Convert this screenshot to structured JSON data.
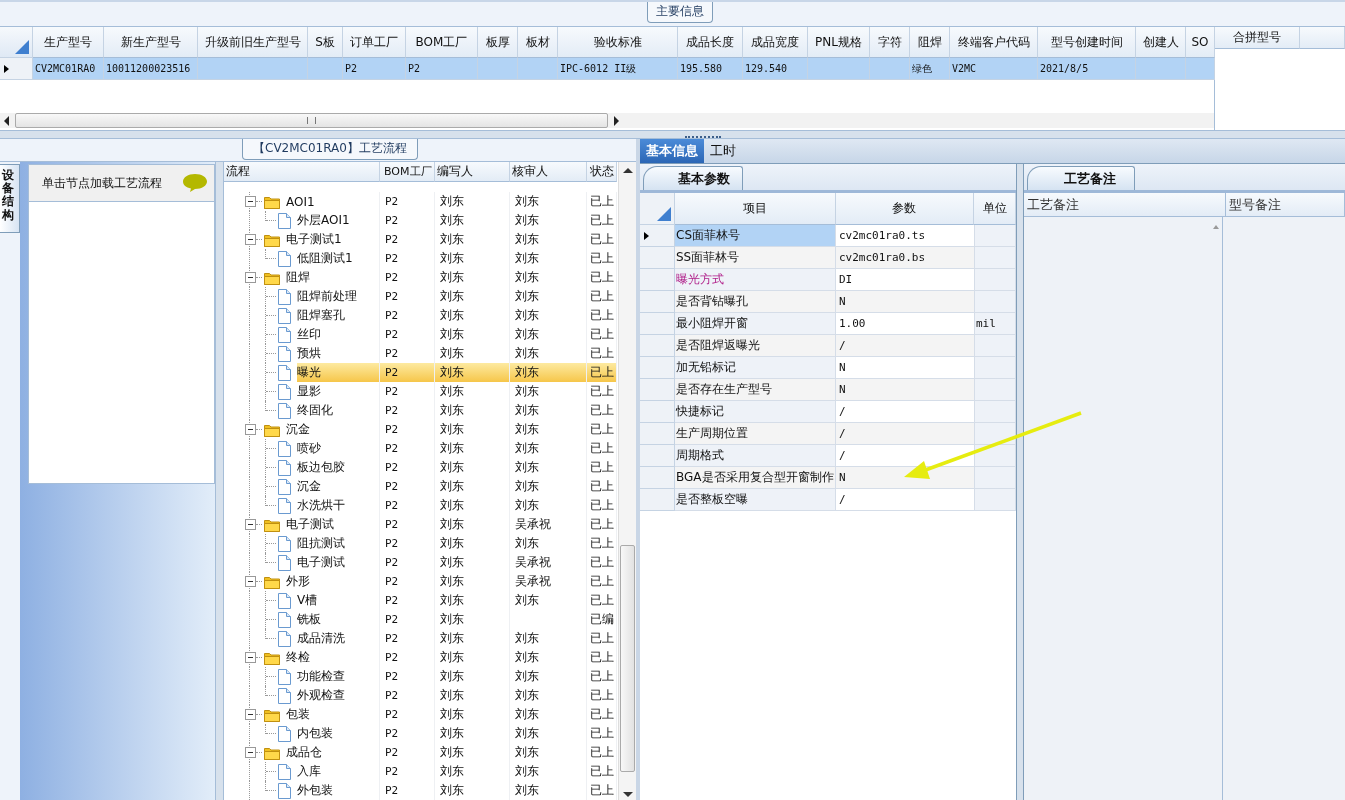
{
  "main_info": {
    "title": "主要信息",
    "columns": [
      "生产型号",
      "新生产型号",
      "升级前旧生产型号",
      "S板",
      "订单工厂",
      "BOM工厂",
      "板厚",
      "板材",
      "验收标准",
      "成品长度",
      "成品宽度",
      "PNL规格",
      "字符",
      "阻焊",
      "终端客户代码",
      "型号创建时间",
      "创建人",
      "SO"
    ],
    "rows": [
      {
        "selected": true,
        "cells": [
          "CV2MC01RA0",
          "10011200023516",
          null,
          null,
          "P2",
          "P2",
          null,
          null,
          "IPC-6012 II级",
          "195.580",
          "129.540",
          null,
          null,
          "绿色",
          "V2MC",
          "2021/8/5",
          null,
          null
        ]
      }
    ],
    "side_columns": [
      "合拼型号"
    ]
  },
  "process": {
    "title": "【CV2MC01RA0】工艺流程",
    "side_tab": {
      "label": "设备结构",
      "selected": true
    },
    "hint": "单击节点加载工艺流程",
    "columns": [
      "流程",
      "BOM工厂",
      "编写人",
      "核审人",
      "状态"
    ],
    "tree": [
      {
        "kind": "folder",
        "label": "AOI1",
        "bom": "P2",
        "writer": "刘东",
        "reviewer": "刘东",
        "status": "已上",
        "selected": false,
        "expanded": true,
        "children": [
          {
            "kind": "file",
            "label": "外层AOI1",
            "bom": "P2",
            "writer": "刘东",
            "reviewer": "刘东",
            "status": "已上",
            "selected": false
          }
        ]
      },
      {
        "kind": "folder",
        "label": "电子测试1",
        "bom": "P2",
        "writer": "刘东",
        "reviewer": "刘东",
        "status": "已上",
        "selected": false,
        "expanded": true,
        "children": [
          {
            "kind": "file",
            "label": "低阻测试1",
            "bom": "P2",
            "writer": "刘东",
            "reviewer": "刘东",
            "status": "已上",
            "selected": false
          }
        ]
      },
      {
        "kind": "folder",
        "label": "阻焊",
        "bom": "P2",
        "writer": "刘东",
        "reviewer": "刘东",
        "status": "已上",
        "selected": false,
        "expanded": true,
        "children": [
          {
            "kind": "file",
            "label": "阻焊前处理",
            "bom": "P2",
            "writer": "刘东",
            "reviewer": "刘东",
            "status": "已上",
            "selected": false
          },
          {
            "kind": "file",
            "label": "阻焊塞孔",
            "bom": "P2",
            "writer": "刘东",
            "reviewer": "刘东",
            "status": "已上",
            "selected": false
          },
          {
            "kind": "file",
            "label": "丝印",
            "bom": "P2",
            "writer": "刘东",
            "reviewer": "刘东",
            "status": "已上",
            "selected": false
          },
          {
            "kind": "file",
            "label": "预烘",
            "bom": "P2",
            "writer": "刘东",
            "reviewer": "刘东",
            "status": "已上",
            "selected": false
          },
          {
            "kind": "file",
            "label": "曝光",
            "bom": "P2",
            "writer": "刘东",
            "reviewer": "刘东",
            "status": "已上",
            "selected": true
          },
          {
            "kind": "file",
            "label": "显影",
            "bom": "P2",
            "writer": "刘东",
            "reviewer": "刘东",
            "status": "已上",
            "selected": false
          },
          {
            "kind": "file",
            "label": "终固化",
            "bom": "P2",
            "writer": "刘东",
            "reviewer": "刘东",
            "status": "已上",
            "selected": false
          }
        ]
      },
      {
        "kind": "folder",
        "label": "沉金",
        "bom": "P2",
        "writer": "刘东",
        "reviewer": "刘东",
        "status": "已上",
        "selected": false,
        "expanded": true,
        "children": [
          {
            "kind": "file",
            "label": "喷砂",
            "bom": "P2",
            "writer": "刘东",
            "reviewer": "刘东",
            "status": "已上",
            "selected": false
          },
          {
            "kind": "file",
            "label": "板边包胶",
            "bom": "P2",
            "writer": "刘东",
            "reviewer": "刘东",
            "status": "已上",
            "selected": false
          },
          {
            "kind": "file",
            "label": "沉金",
            "bom": "P2",
            "writer": "刘东",
            "reviewer": "刘东",
            "status": "已上",
            "selected": false
          },
          {
            "kind": "file",
            "label": "水洗烘干",
            "bom": "P2",
            "writer": "刘东",
            "reviewer": "刘东",
            "status": "已上",
            "selected": false
          }
        ]
      },
      {
        "kind": "folder",
        "label": "电子测试",
        "bom": "P2",
        "writer": "刘东",
        "reviewer": "吴承祝",
        "status": "已上",
        "selected": false,
        "expanded": true,
        "children": [
          {
            "kind": "file",
            "label": "阻抗测试",
            "bom": "P2",
            "writer": "刘东",
            "reviewer": "刘东",
            "status": "已上",
            "selected": false
          },
          {
            "kind": "file",
            "label": "电子测试",
            "bom": "P2",
            "writer": "刘东",
            "reviewer": "吴承祝",
            "status": "已上",
            "selected": false
          }
        ]
      },
      {
        "kind": "folder",
        "label": "外形",
        "bom": "P2",
        "writer": "刘东",
        "reviewer": "吴承祝",
        "status": "已上",
        "selected": false,
        "expanded": true,
        "children": [
          {
            "kind": "file",
            "label": "V槽",
            "bom": "P2",
            "writer": "刘东",
            "reviewer": "刘东",
            "status": "已上",
            "selected": false
          },
          {
            "kind": "file",
            "label": "铣板",
            "bom": "P2",
            "writer": "刘东",
            "status": "已编",
            "selected": false
          },
          {
            "kind": "file",
            "label": "成品清洗",
            "bom": "P2",
            "writer": "刘东",
            "reviewer": "刘东",
            "status": "已上",
            "selected": false
          }
        ]
      },
      {
        "kind": "folder",
        "label": "终检",
        "bom": "P2",
        "writer": "刘东",
        "reviewer": "刘东",
        "status": "已上",
        "selected": false,
        "expanded": true,
        "children": [
          {
            "kind": "file",
            "label": "功能检查",
            "bom": "P2",
            "writer": "刘东",
            "reviewer": "刘东",
            "status": "已上",
            "selected": false
          },
          {
            "kind": "file",
            "label": "外观检查",
            "bom": "P2",
            "writer": "刘东",
            "reviewer": "刘东",
            "status": "已上",
            "selected": false
          }
        ]
      },
      {
        "kind": "folder",
        "label": "包装",
        "bom": "P2",
        "writer": "刘东",
        "reviewer": "刘东",
        "status": "已上",
        "selected": false,
        "expanded": true,
        "children": [
          {
            "kind": "file",
            "label": "内包装",
            "bom": "P2",
            "writer": "刘东",
            "reviewer": "刘东",
            "status": "已上",
            "selected": false
          }
        ]
      },
      {
        "kind": "folder",
        "label": "成品仓",
        "bom": "P2",
        "writer": "刘东",
        "reviewer": "刘东",
        "status": "已上",
        "selected": false,
        "expanded": true,
        "children": [
          {
            "kind": "file",
            "label": "入库",
            "bom": "P2",
            "writer": "刘东",
            "reviewer": "刘东",
            "status": "已上",
            "selected": false
          },
          {
            "kind": "file",
            "label": "外包装",
            "bom": "P2",
            "writer": "刘东",
            "reviewer": "刘东",
            "status": "已上",
            "selected": false
          }
        ]
      }
    ]
  },
  "detail": {
    "tabs": [
      {
        "label": "基本信息",
        "selected": true
      },
      {
        "label": "工时",
        "selected": false
      }
    ],
    "params": {
      "tab": "基本参数",
      "columns": [
        "项目",
        "参数",
        "单位"
      ],
      "rows": [
        {
          "item": "CS面菲林号",
          "value": "cv2mc01ra0.ts",
          "selected": true,
          "highlighted": false
        },
        {
          "item": "SS面菲林号",
          "value": "cv2mc01ra0.bs",
          "selected": false,
          "highlighted": false
        },
        {
          "item": "曝光方式",
          "value": "DI",
          "selected": false,
          "highlighted": true
        },
        {
          "item": "是否背钻曝孔",
          "value": "N",
          "selected": false,
          "highlighted": false
        },
        {
          "item": "最小阻焊开窗",
          "value": "1.00",
          "unit": "mil",
          "selected": false,
          "highlighted": false
        },
        {
          "item": "是否阻焊返曝光",
          "value": "/",
          "selected": false,
          "highlighted": false
        },
        {
          "item": "加无铅标记",
          "value": "N",
          "selected": false,
          "highlighted": false
        },
        {
          "item": "是否存在生产型号",
          "value": "N",
          "selected": false,
          "highlighted": false
        },
        {
          "item": "快捷标记",
          "value": "/",
          "selected": false,
          "highlighted": false
        },
        {
          "item": "生产周期位置",
          "value": "/",
          "selected": false,
          "highlighted": false
        },
        {
          "item": "周期格式",
          "value": "/",
          "selected": false,
          "highlighted": false
        },
        {
          "item": "BGA是否采用复合型开窗制作",
          "value": "N",
          "selected": false,
          "highlighted": false
        },
        {
          "item": "是否整板空曝",
          "value": "/",
          "selected": false,
          "highlighted": false
        }
      ]
    },
    "notes": {
      "tab": "工艺备注",
      "columns": [
        "工艺备注",
        "型号备注"
      ]
    }
  }
}
